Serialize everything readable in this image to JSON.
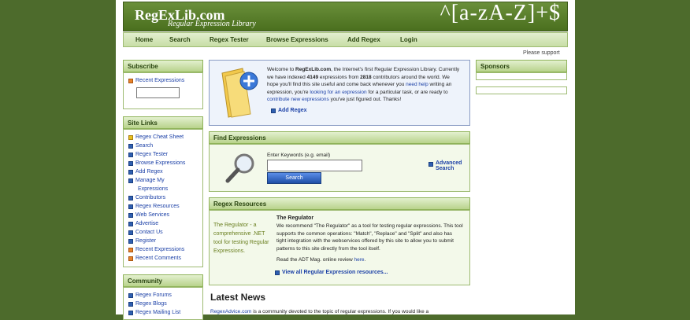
{
  "header": {
    "logo": "RegExLib.com",
    "tagline": "Regular Expression Library",
    "regex_art": "^[a-zA-Z]+$"
  },
  "nav": {
    "items": [
      "Home",
      "Search",
      "Regex Tester",
      "Browse Expressions",
      "Add Regex",
      "Login"
    ]
  },
  "support_text": "Please support",
  "subscribe": {
    "title": "Subscribe",
    "link": "Recent Expressions",
    "input_value": ""
  },
  "site_links": {
    "title": "Site Links",
    "items": [
      "Regex Cheat Sheet",
      "Search",
      "Regex Tester",
      "Browse Expressions",
      "Add Regex",
      "Manage My",
      "Expressions",
      "Contributors",
      "Regex Resources",
      "Web Services",
      "Advertise",
      "Contact Us",
      "Register",
      "Recent Expressions",
      "Recent Comments"
    ]
  },
  "community": {
    "title": "Community",
    "items": [
      "Regex Forums",
      "Regex Blogs",
      "Regex Mailing List"
    ]
  },
  "welcome": {
    "line1a": "Welcome to ",
    "line1b": "RegExLib.com",
    ", the Internet's first Regular Expression Library. Currently": "",
    "l1": ", the Internet's first Regular Expression Library. Currently",
    "l2a": "we have indexed ",
    "count_expr": "4149",
    "l2b": " expressions from ",
    "count_contrib": "2818",
    "l2c": " contributors around the world. We",
    "l3a": "hope you'll find this site useful and come back whenever you ",
    "need_help": "need help",
    "l3b": " writing an",
    "l4a": "expression, you're ",
    "looking": "looking for an expression",
    "l4b": " for a particular task, or are ready to",
    "contribute": "contribute new expressions",
    "l5b": " you've just figured out. Thanks!",
    "add_regex": "Add Regex"
  },
  "find": {
    "title": "Find Expressions",
    "keywords_label": "Enter Keywords (e.g. email)",
    "search_button": "Search",
    "advanced1": "Advanced",
    "advanced2": "Search"
  },
  "resources": {
    "title": "Regex Resources",
    "promo1": "The Regulator - a",
    "promo2": "comprehensive .NET",
    "promo3": "tool for testing Regular",
    "promo4": "Expressions.",
    "heading": "The Regulator",
    "d1": "We recommend \"The Regulator\" as a tool for testing regular expressions. This tool",
    "d2": "supports the common operations: \"Match\", \"Replace\" and \"Split\" and also has",
    "d3": "tight integration with the webservices offered by this site to allow you to submit",
    "d4": "patterns to this site directly from the tool itself.",
    "read_a": "Read the ADT Mag. online review ",
    "here": "here",
    "view_all": "View all Regular Expression resources..."
  },
  "news": {
    "title": "Latest News",
    "link": "RegexAdvice.com",
    "text": " is a community devoted to the topic of regular expressions. If you would like a"
  },
  "sponsors": {
    "title": "Sponsors"
  }
}
